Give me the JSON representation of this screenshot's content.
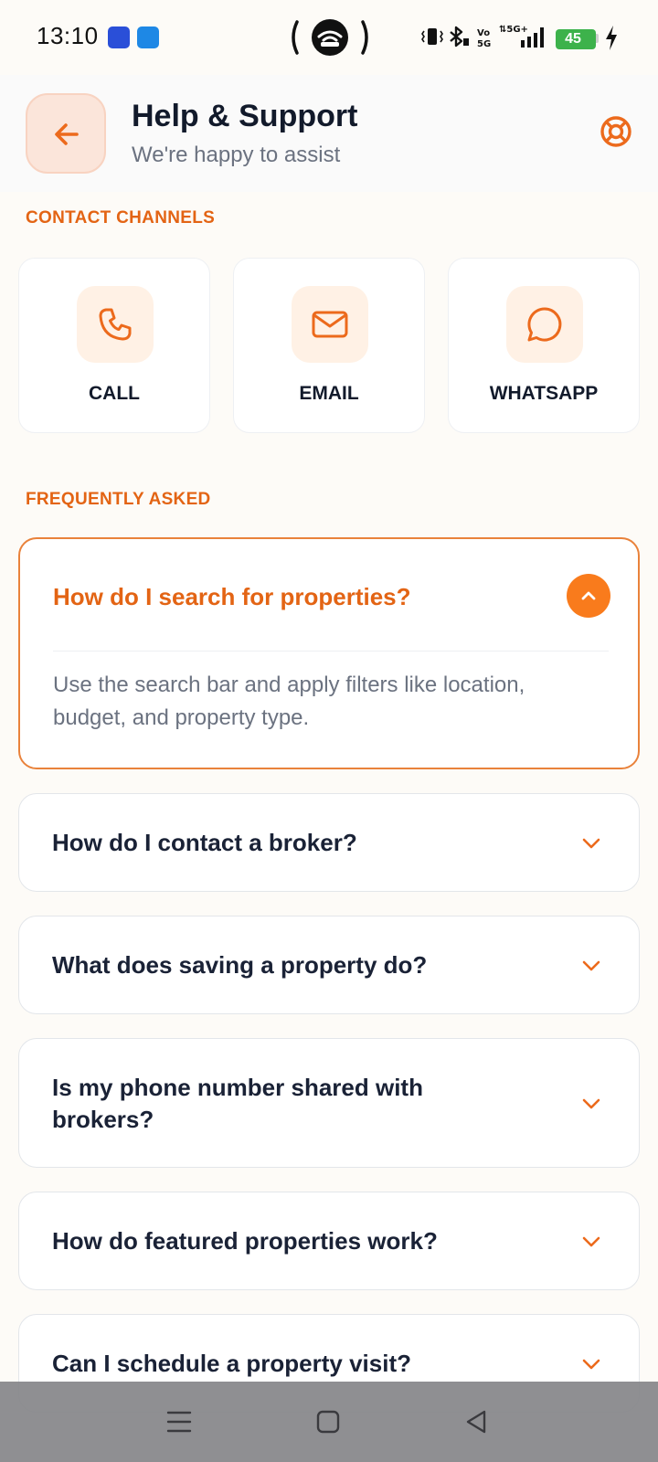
{
  "status_bar": {
    "time": "13:10",
    "battery": "45",
    "app_icons": [
      "travel-app-icon",
      "cloud-app-icon"
    ]
  },
  "header": {
    "title": "Help & Support",
    "subtitle": "We're happy to assist"
  },
  "contact": {
    "section_label": "CONTACT CHANNELS",
    "channels": [
      {
        "label": "CALL",
        "icon": "phone-icon"
      },
      {
        "label": "EMAIL",
        "icon": "mail-icon"
      },
      {
        "label": "WHATSAPP",
        "icon": "chat-bubble-icon"
      }
    ]
  },
  "faq": {
    "section_label": "FREQUENTLY ASKED",
    "items": [
      {
        "question": "How do I search for properties?",
        "answer": "Use the search bar and apply filters like location, budget, and property type.",
        "expanded": true
      },
      {
        "question": "How do I contact a broker?",
        "expanded": false
      },
      {
        "question": "What does saving a property do?",
        "expanded": false
      },
      {
        "question": "Is my phone number shared with brokers?",
        "expanded": false
      },
      {
        "question": "How do featured properties work?",
        "expanded": false
      },
      {
        "question": "Can I schedule a property visit?",
        "expanded": false
      }
    ]
  },
  "colors": {
    "accent": "#e36414",
    "accent_bright": "#f97b1c",
    "background": "#fdfbf7"
  }
}
